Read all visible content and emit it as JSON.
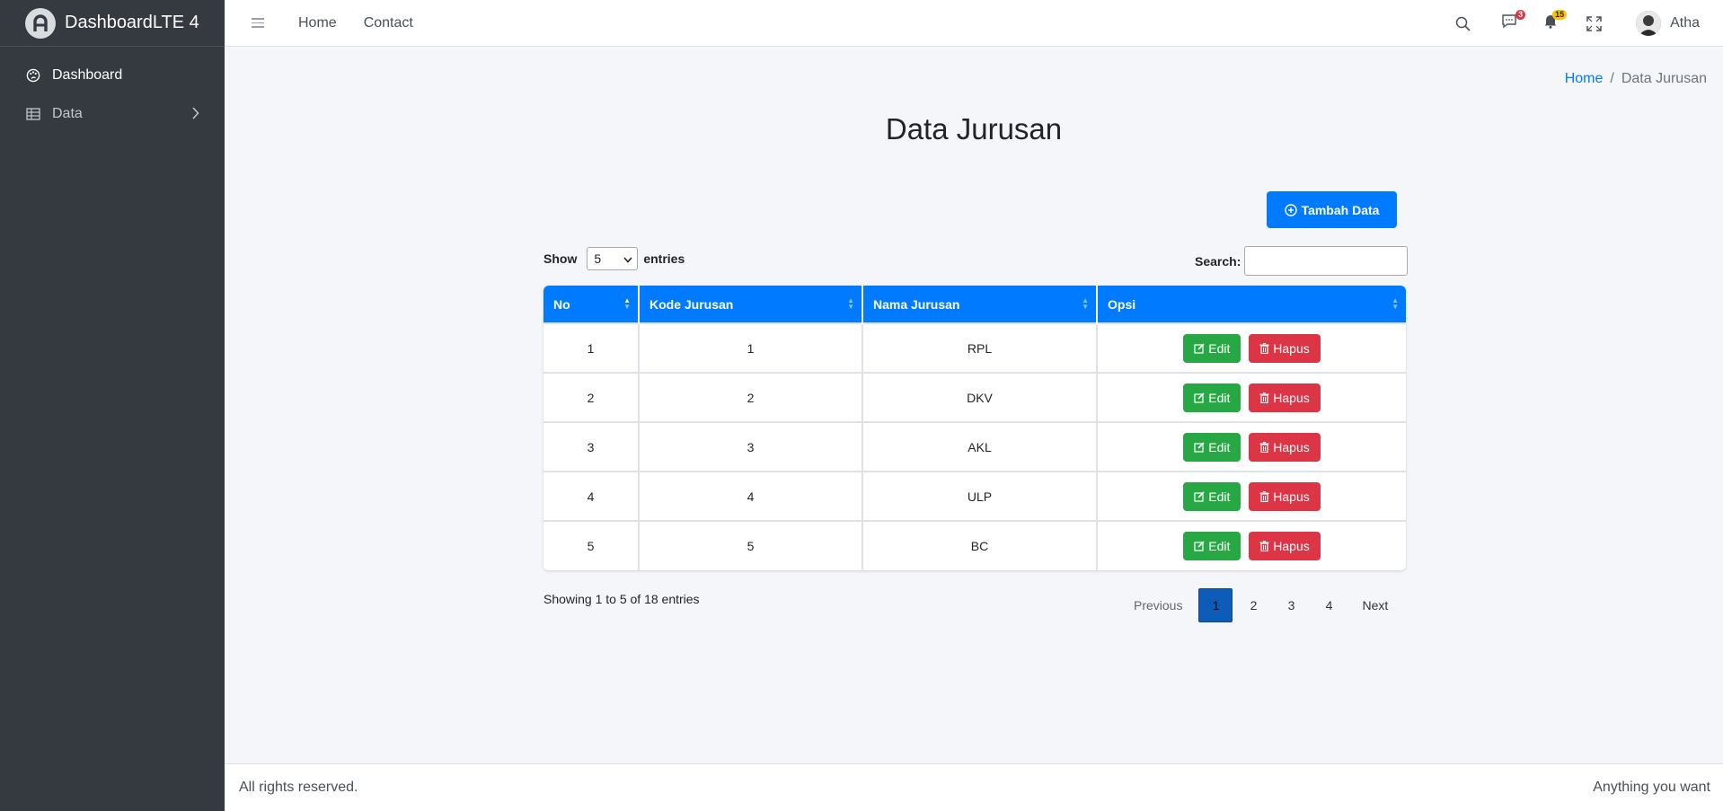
{
  "brand": {
    "name": "DashboardLTE 4"
  },
  "sidebar": {
    "items": [
      {
        "label": "Dashboard",
        "icon": "palette-icon"
      },
      {
        "label": "Data",
        "icon": "table-icon"
      }
    ]
  },
  "topbar": {
    "links": [
      "Home",
      "Contact"
    ],
    "messages_badge": "3",
    "notifications_badge": "15",
    "user_name": "Atha"
  },
  "breadcrumb": {
    "home": "Home",
    "separator": "/",
    "current": "Data Jurusan"
  },
  "page": {
    "title": "Data Jurusan",
    "add_button": "Tambah Data"
  },
  "datatable": {
    "show_label": "Show",
    "entries_label": "entries",
    "page_length": "5",
    "search_label": "Search:",
    "search_value": "",
    "columns": [
      "No",
      "Kode Jurusan",
      "Nama Jurusan",
      "Opsi"
    ],
    "rows": [
      {
        "no": "1",
        "kode": "1",
        "nama": "RPL"
      },
      {
        "no": "2",
        "kode": "2",
        "nama": "DKV"
      },
      {
        "no": "3",
        "kode": "3",
        "nama": "AKL"
      },
      {
        "no": "4",
        "kode": "4",
        "nama": "ULP"
      },
      {
        "no": "5",
        "kode": "5",
        "nama": "BC"
      }
    ],
    "edit_label": "Edit",
    "delete_label": "Hapus",
    "info": "Showing 1 to 5 of 18 entries",
    "pagination": {
      "previous": "Previous",
      "pages": [
        "1",
        "2",
        "3",
        "4"
      ],
      "current": "1",
      "next": "Next"
    }
  },
  "footer": {
    "left": "All rights reserved.",
    "right": "Anything you want"
  },
  "colors": {
    "primary": "#007bff",
    "success": "#28a745",
    "danger": "#dc3545",
    "sidebar": "#343a40",
    "warning": "#ffc107"
  }
}
